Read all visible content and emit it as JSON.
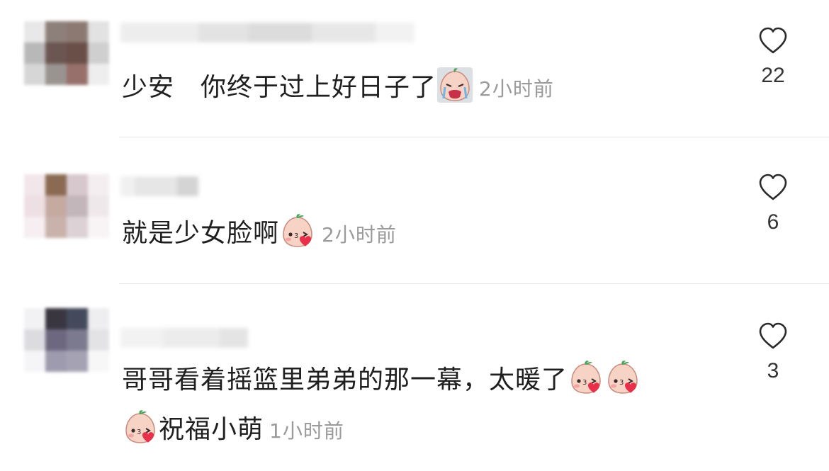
{
  "comments": [
    {
      "text": "少安　你终于过上好日子了",
      "emojis": [
        "crying-face-icon"
      ],
      "time": "2小时前",
      "likes": "22",
      "liked": false
    },
    {
      "text": "就是少女脸啊",
      "emojis": [
        "blowing-kiss-icon"
      ],
      "time": "2小时前",
      "likes": "6",
      "liked": false
    },
    {
      "text_line1": "哥哥看着摇篮里弟弟的那一幕，太暖了",
      "text_line2": "祝福小萌",
      "emojis": [
        "blowing-kiss-icon",
        "blowing-kiss-icon",
        "blowing-kiss-icon"
      ],
      "time": "1小时前",
      "likes": "3",
      "liked": false
    }
  ],
  "colors": {
    "text": "#1f1f1f",
    "time": "#9a9a9a",
    "divider": "#e6e6e6",
    "heart_outline": "#2a2a2a"
  }
}
